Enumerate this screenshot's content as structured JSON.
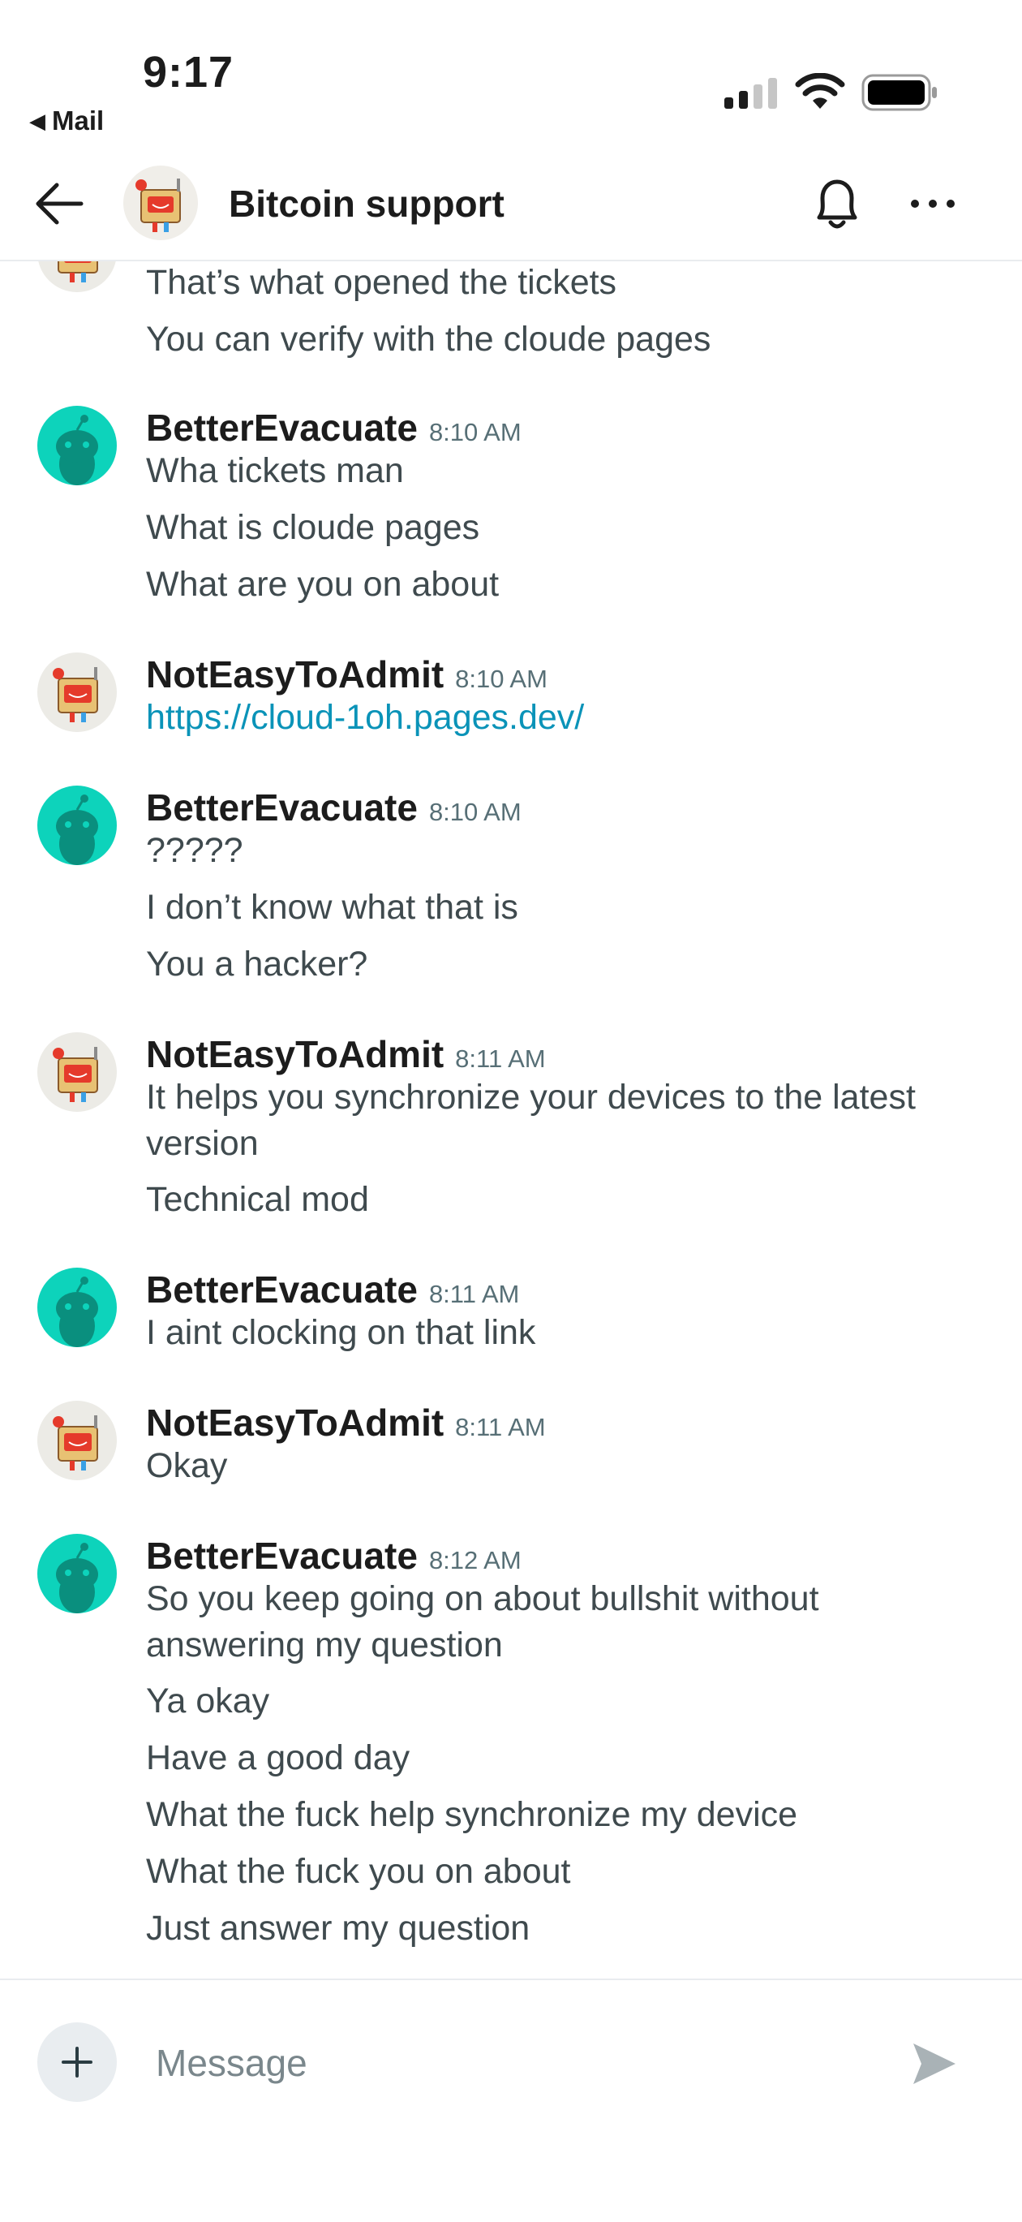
{
  "status_bar": {
    "time": "9:17",
    "back_app": "Mail",
    "back_glyph": "◀"
  },
  "header": {
    "title": "Bitcoin support"
  },
  "messages": [
    {
      "user": "",
      "time": "",
      "avatar": "robot-avatar",
      "lines": [
        "That’s what opened the tickets",
        "You can verify with the cloude pages"
      ]
    },
    {
      "user": "BetterEvacuate",
      "time": "8:10 AM",
      "avatar": "snoo-green-avatar",
      "lines": [
        "Wha tickets man",
        "What is cloude pages",
        "What are you on about"
      ]
    },
    {
      "user": "NotEasyToAdmit",
      "time": "8:10 AM",
      "avatar": "robot-avatar",
      "lines": [
        "https://cloud-1oh.pages.dev/"
      ]
    },
    {
      "user": "BetterEvacuate",
      "time": "8:10 AM",
      "avatar": "snoo-green-avatar",
      "lines": [
        "?????",
        "I don’t know what that is",
        "You a hacker?"
      ]
    },
    {
      "user": "NotEasyToAdmit",
      "time": "8:11 AM",
      "avatar": "robot-avatar",
      "lines": [
        "It helps you synchronize your devices to the latest version",
        "Technical mod"
      ]
    },
    {
      "user": "BetterEvacuate",
      "time": "8:11 AM",
      "avatar": "snoo-green-avatar",
      "lines": [
        "I aint clocking on that link"
      ]
    },
    {
      "user": "NotEasyToAdmit",
      "time": "8:11 AM",
      "avatar": "robot-avatar",
      "lines": [
        "Okay"
      ]
    },
    {
      "user": "BetterEvacuate",
      "time": "8:12 AM",
      "avatar": "snoo-green-avatar",
      "lines": [
        "So you keep going on about bullshit without answering my question",
        "Ya okay",
        "Have a good day",
        "What the fuck help synchronize my device",
        "What the fuck you on about",
        "Just answer my question"
      ]
    }
  ],
  "composer": {
    "placeholder": "Message"
  },
  "colors": {
    "link": "#0a93b8",
    "snoo_green": "#0dd3bb",
    "username": "#1c1c1c",
    "timestamp": "#576f76"
  }
}
